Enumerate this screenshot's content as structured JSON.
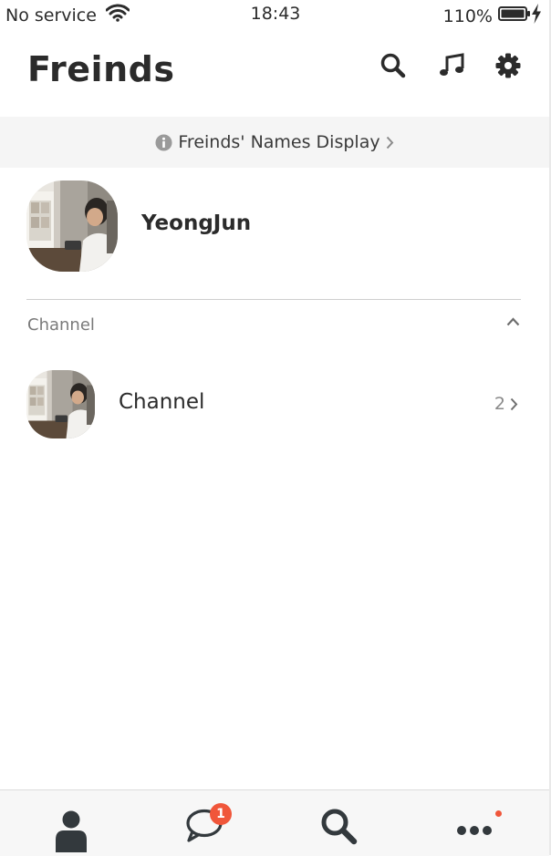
{
  "status_bar": {
    "carrier": "No service",
    "time": "18:43",
    "battery": "110%"
  },
  "header": {
    "title": "Freinds",
    "icons": [
      "search-icon",
      "music-icon",
      "gear-icon"
    ]
  },
  "banner": {
    "text": "Freinds' Names Display"
  },
  "profile": {
    "name": "YeongJun"
  },
  "channel_section": {
    "title": "Channel",
    "items": [
      {
        "name": "Channel",
        "count": "2"
      }
    ]
  },
  "tab_bar": {
    "tabs": [
      "person-icon",
      "chat-icon",
      "search-icon",
      "more-icon"
    ],
    "chat_badge": "1"
  },
  "colors": {
    "badge": "#f0563a",
    "text": "#2b2b2b",
    "banner_bg": "#f5f5f5"
  }
}
